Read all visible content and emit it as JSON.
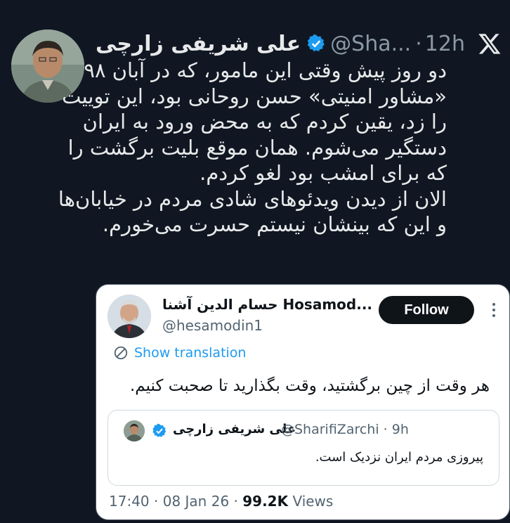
{
  "tweet": {
    "display_name": "علی شریفی زارچی",
    "handle": "@Sha...",
    "separator": "·",
    "time": "12h",
    "body_lines": [
      "دو روز پیش وقتی این مامور، که در آبان ۹۸",
      "«مشاور امنیتی» حسن روحانی بود، این توییت",
      "را زد، یقین کردم که به محض ورود به ایران",
      "دستگیر می‌شوم. همان موقع بلیت برگشت را",
      "که برای امشب بود لغو کردم.",
      "الان از دیدن ویدئوهای شادی مردم در خیابان‌ها",
      "و این که بینشان نیستم حسرت می‌خورم."
    ]
  },
  "embed": {
    "name": "حسام الدین آشنا Hosamod...",
    "handle": "@hesamodin1",
    "follow_label": "Follow",
    "translate_label": "Show translation",
    "text": "هر وقت از چین برگشتید، وقت بگذارید تا صحبت کنیم.",
    "quote": {
      "name": "علی شریفی زارچی",
      "handle": "@SharifiZarchi",
      "separator": "·",
      "time": "9h",
      "text": "پیروزی مردم ایران نزدیک است."
    },
    "footer": {
      "time": "17:40",
      "sep1": "·",
      "date": "08 Jan 26",
      "sep2": "·",
      "views_count": "99.2K",
      "views_label": "Views"
    }
  },
  "colors": {
    "background": "#101722",
    "verified": "#1d9bf0",
    "link": "#1d9bf0"
  }
}
